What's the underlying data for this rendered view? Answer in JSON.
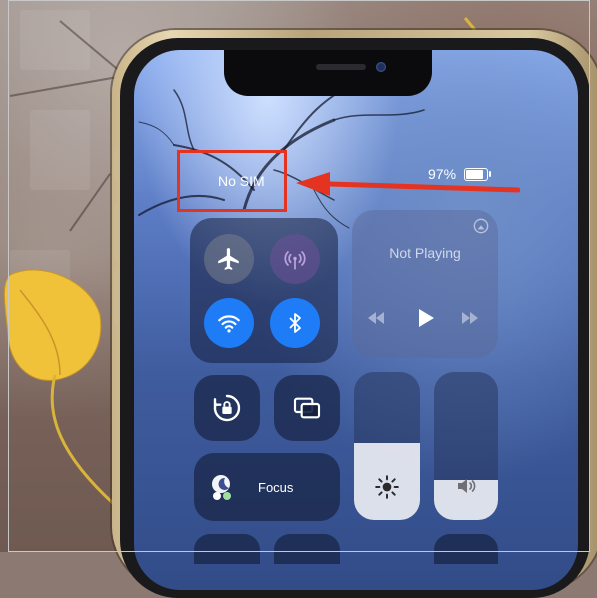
{
  "status_bar": {
    "carrier": "No SIM",
    "battery_percent": "97%",
    "battery_level": 0.97
  },
  "control_center": {
    "connectivity": [
      {
        "name": "airplane-mode",
        "icon": "airplane-icon",
        "state": "off"
      },
      {
        "name": "cellular-data",
        "icon": "antenna-icon",
        "state": "disabled"
      },
      {
        "name": "wifi",
        "icon": "wifi-icon",
        "state": "on"
      },
      {
        "name": "bluetooth",
        "icon": "bluetooth-icon",
        "state": "on"
      }
    ],
    "now_playing": {
      "label": "Not Playing",
      "controls": [
        "rewind-icon",
        "play-icon",
        "fast-forward-icon"
      ],
      "airplay_icon": "airplay-icon"
    },
    "orientation_lock_icon": "rotation-lock-icon",
    "screen_mirroring_icon": "screen-mirroring-icon",
    "focus": {
      "label": "Focus",
      "icon": "moon-icon"
    },
    "brightness": {
      "icon": "sun-icon",
      "level": 0.52
    },
    "volume": {
      "icon": "speaker-icon",
      "level": 0.27
    }
  },
  "annotation": {
    "box_color": "#e53322",
    "arrow_color": "#e53322",
    "target": "carrier"
  },
  "colors": {
    "accent_blue": "#1e7cf6",
    "annotation_red": "#e53322"
  }
}
